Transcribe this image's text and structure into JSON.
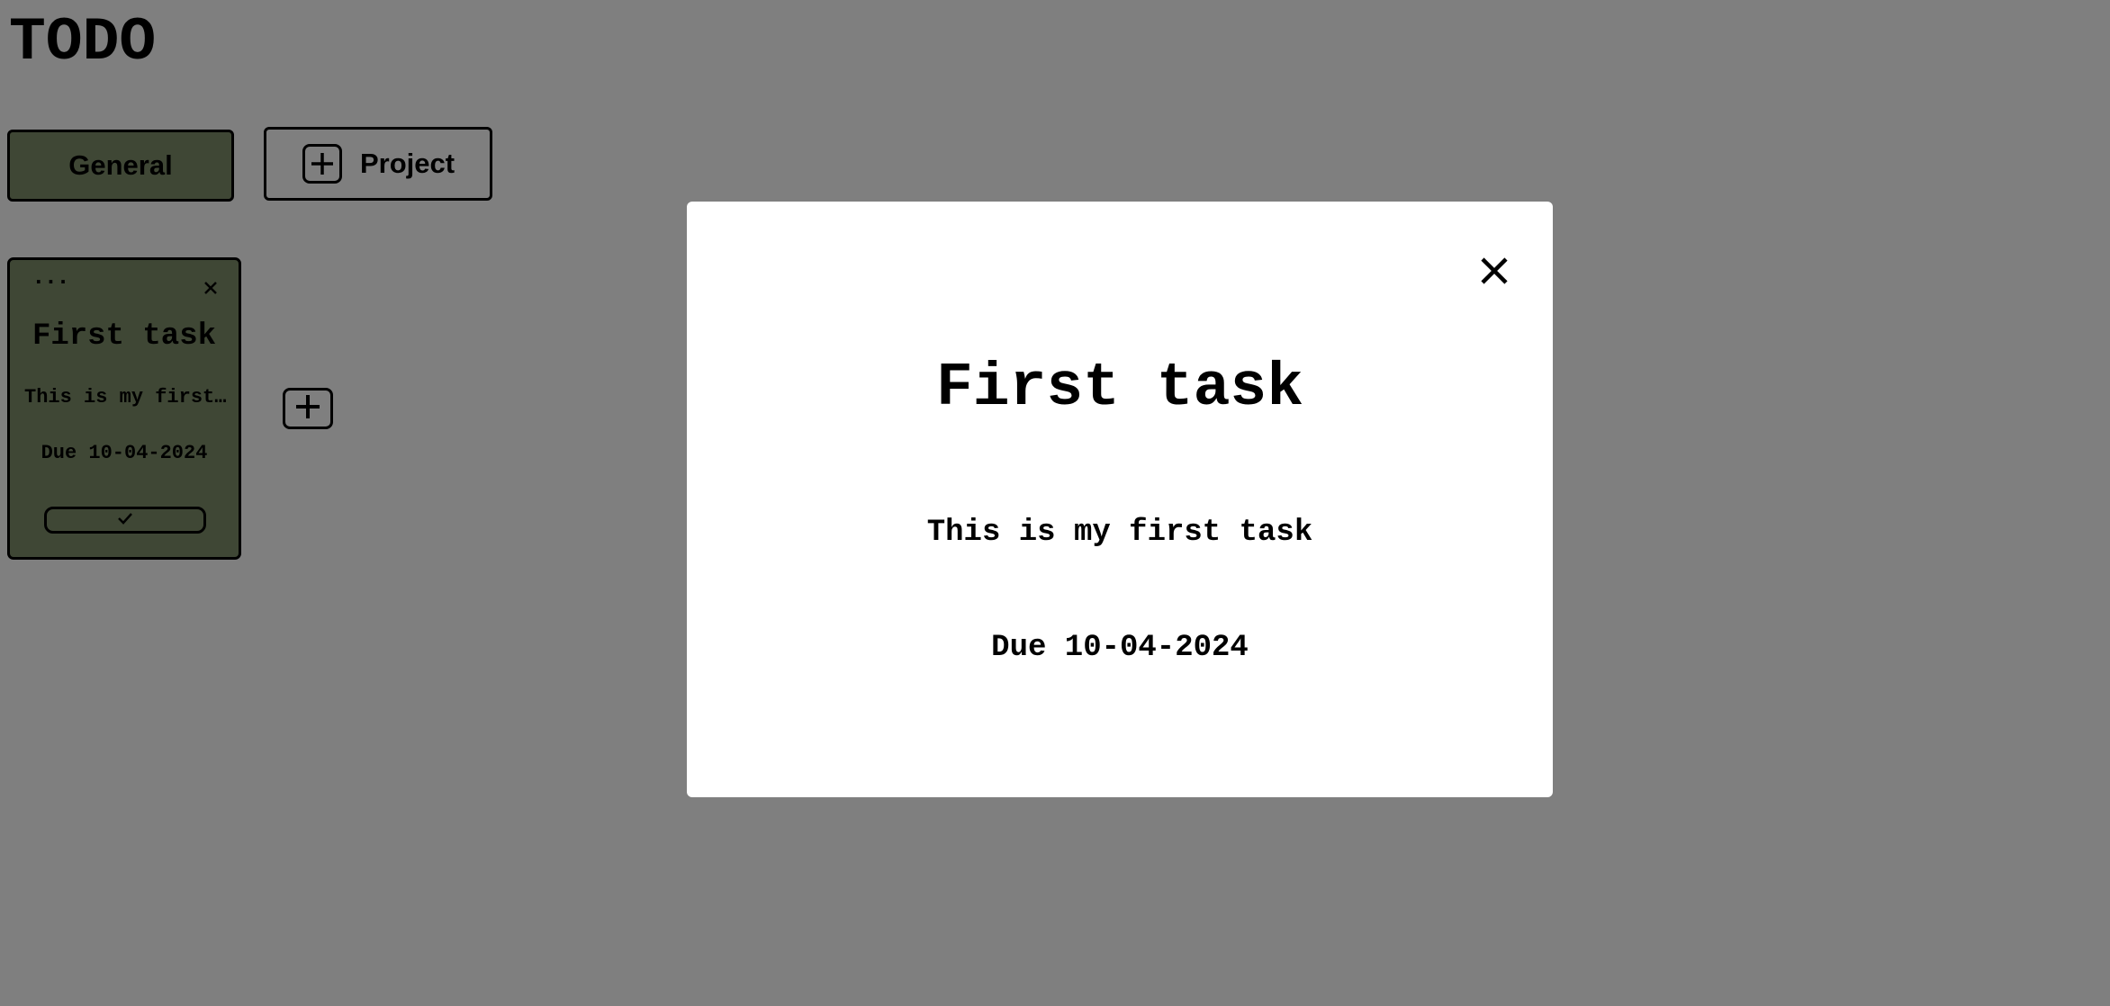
{
  "app": {
    "title": "TODO"
  },
  "projects": {
    "tabs": [
      {
        "label": "General",
        "active": true
      }
    ],
    "add_project_label": "Project"
  },
  "tasks": [
    {
      "menu_label": "...",
      "title": "First task",
      "description": "This is my first task",
      "due": "Due 10-04-2024"
    }
  ],
  "modal": {
    "title": "First task",
    "description": "This is my first task",
    "due": "Due 10-04-2024"
  },
  "icons": {
    "add_project": "plus-icon",
    "add_task": "plus-icon",
    "card_close": "close-icon",
    "card_complete": "check-icon",
    "modal_close": "close-icon"
  },
  "colors": {
    "page_background": "#ffffff",
    "project_green": "#7f8f6a",
    "overlay": "rgba(0,0,0,0.5)",
    "modal_background": "#ffffff"
  }
}
